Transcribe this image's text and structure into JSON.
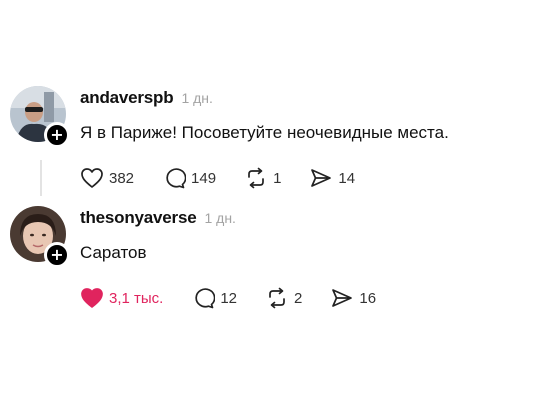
{
  "posts": [
    {
      "username": "andaverspb",
      "time": "1 дн.",
      "text": "Я в Париже! Посоветуйте неочевидные места.",
      "likes": "382",
      "replies": "149",
      "reposts": "1",
      "shares": "14",
      "liked": false
    },
    {
      "username": "thesonyaverse",
      "time": "1 дн.",
      "text": "Саратов",
      "likes": "3,1 тыс.",
      "replies": "12",
      "reposts": "2",
      "shares": "16",
      "liked": true
    }
  ],
  "colors": {
    "like_active": "#e0245e",
    "muted": "#a3a3a3"
  }
}
